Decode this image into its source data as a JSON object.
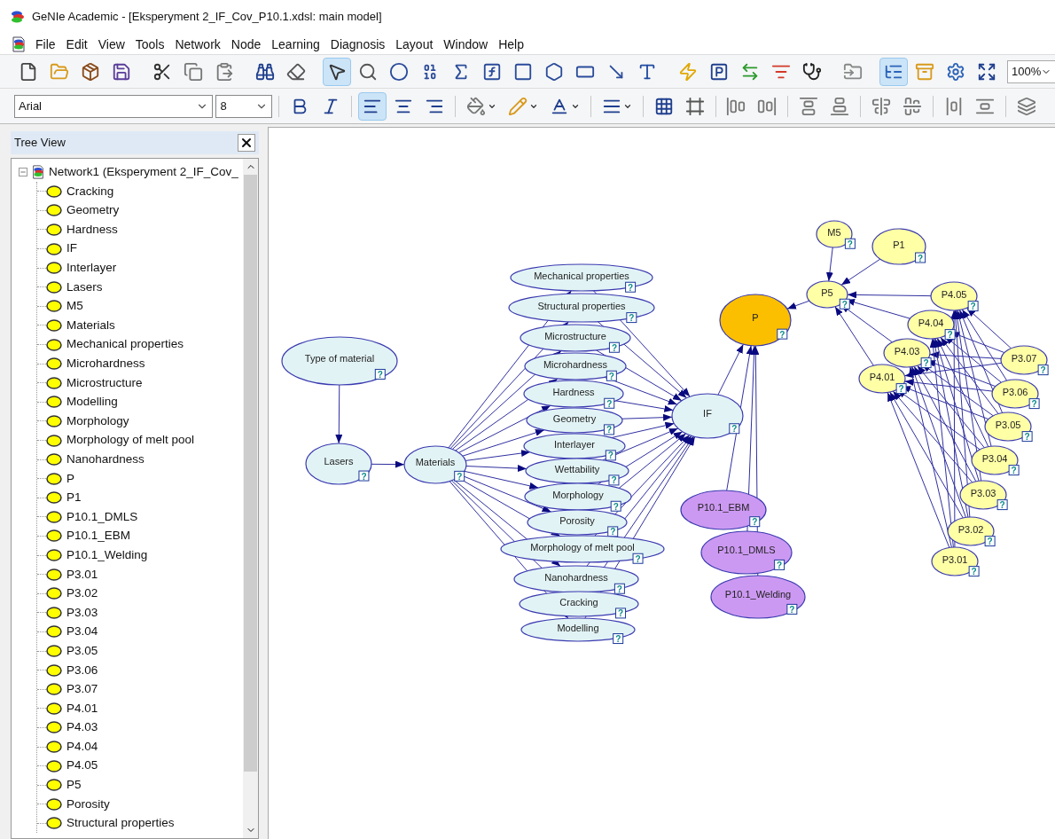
{
  "window": {
    "title": "GeNIe Academic - [Eksperyment 2_IF_Cov_P10.1.xdsl: main model]"
  },
  "menu": [
    "File",
    "Edit",
    "View",
    "Tools",
    "Network",
    "Node",
    "Learning",
    "Diagnosis",
    "Layout",
    "Window",
    "Help"
  ],
  "toolbar_main": {
    "buttons": [
      {
        "kind": "new",
        "pressed": false
      },
      {
        "kind": "open",
        "pressed": false
      },
      {
        "kind": "package",
        "pressed": false
      },
      {
        "kind": "save",
        "pressed": false
      },
      {
        "kind": "separator"
      },
      {
        "kind": "cut",
        "pressed": false
      },
      {
        "kind": "copy",
        "pressed": false
      },
      {
        "kind": "paste",
        "pressed": false
      },
      {
        "kind": "separator"
      },
      {
        "kind": "find",
        "pressed": false
      },
      {
        "kind": "erase",
        "pressed": false
      },
      {
        "kind": "separator"
      },
      {
        "kind": "select",
        "pressed": true
      },
      {
        "kind": "zoom",
        "pressed": false
      },
      {
        "kind": "chance",
        "pressed": false
      },
      {
        "kind": "deterministic",
        "pressed": false
      },
      {
        "kind": "equation",
        "pressed": false
      },
      {
        "kind": "function",
        "pressed": false
      },
      {
        "kind": "rectangle",
        "pressed": false
      },
      {
        "kind": "hexagon",
        "pressed": false
      },
      {
        "kind": "rounded",
        "pressed": false
      },
      {
        "kind": "arc",
        "pressed": false
      },
      {
        "kind": "text",
        "pressed": false
      },
      {
        "kind": "separator"
      },
      {
        "kind": "update",
        "pressed": false
      },
      {
        "kind": "probability",
        "pressed": false
      },
      {
        "kind": "strength",
        "pressed": false
      },
      {
        "kind": "funnel",
        "pressed": false
      },
      {
        "kind": "diagnose",
        "pressed": false
      },
      {
        "kind": "separator"
      },
      {
        "kind": "submodel",
        "pressed": false
      },
      {
        "kind": "separator"
      },
      {
        "kind": "tree",
        "pressed": true
      },
      {
        "kind": "cases",
        "pressed": false
      },
      {
        "kind": "settings",
        "pressed": false
      },
      {
        "kind": "fit",
        "pressed": false
      }
    ],
    "zoom": "100%"
  },
  "toolbar_format": {
    "font": "Arial",
    "size": "8",
    "buttons": [
      {
        "kind": "bold",
        "pressed": false
      },
      {
        "kind": "italic",
        "pressed": false
      },
      {
        "kind": "separator"
      },
      {
        "kind": "align-left",
        "pressed": true
      },
      {
        "kind": "align-center",
        "pressed": false
      },
      {
        "kind": "align-right",
        "pressed": false
      },
      {
        "kind": "separator"
      },
      {
        "kind": "fill",
        "pressed": false
      },
      {
        "kind": "line-color",
        "pressed": false
      },
      {
        "kind": "font-color",
        "pressed": false
      },
      {
        "kind": "separator"
      },
      {
        "kind": "line-width",
        "pressed": false
      },
      {
        "kind": "separator"
      },
      {
        "kind": "grid",
        "pressed": false
      },
      {
        "kind": "snap",
        "pressed": false
      },
      {
        "kind": "separator"
      },
      {
        "kind": "align-lefts",
        "pressed": false
      },
      {
        "kind": "align-rights",
        "pressed": false
      },
      {
        "kind": "separator"
      },
      {
        "kind": "align-tops",
        "pressed": false
      },
      {
        "kind": "align-bottoms",
        "pressed": false
      },
      {
        "kind": "separator"
      },
      {
        "kind": "center-vertical",
        "pressed": false
      },
      {
        "kind": "center-horizontal",
        "pressed": false
      },
      {
        "kind": "separator"
      },
      {
        "kind": "space-horizontal",
        "pressed": false
      },
      {
        "kind": "space-vertical",
        "pressed": false
      },
      {
        "kind": "separator"
      },
      {
        "kind": "same-size",
        "pressed": false
      }
    ]
  },
  "tree_view": {
    "title": "Tree View",
    "root": {
      "label": "Network1 (Eksperyment 2_IF_Cov_",
      "expanded": true,
      "children": [
        {
          "label": "Cracking"
        },
        {
          "label": "Geometry"
        },
        {
          "label": "Hardness"
        },
        {
          "label": "IF"
        },
        {
          "label": "Interlayer"
        },
        {
          "label": "Lasers"
        },
        {
          "label": "M5"
        },
        {
          "label": "Materials"
        },
        {
          "label": "Mechanical properties"
        },
        {
          "label": "Microhardness"
        },
        {
          "label": "Microstructure"
        },
        {
          "label": "Modelling"
        },
        {
          "label": "Morphology"
        },
        {
          "label": "Morphology of melt pool"
        },
        {
          "label": "Nanohardness"
        },
        {
          "label": "P"
        },
        {
          "label": "P1"
        },
        {
          "label": "P10.1_DMLS"
        },
        {
          "label": "P10.1_EBM"
        },
        {
          "label": "P10.1_Welding"
        },
        {
          "label": "P3.01"
        },
        {
          "label": "P3.02"
        },
        {
          "label": "P3.03"
        },
        {
          "label": "P3.04"
        },
        {
          "label": "P3.05"
        },
        {
          "label": "P3.06"
        },
        {
          "label": "P3.07"
        },
        {
          "label": "P4.01"
        },
        {
          "label": "P4.03"
        },
        {
          "label": "P4.04"
        },
        {
          "label": "P4.05"
        },
        {
          "label": "P5"
        },
        {
          "label": "Porosity"
        },
        {
          "label": "Structural properties"
        }
      ]
    }
  },
  "network": {
    "nodes": [
      {
        "label": "Type of material",
        "color": "#e2f3f5",
        "badge": "?"
      },
      {
        "label": "Lasers",
        "color": "#e2f3f5",
        "badge": "?"
      },
      {
        "label": "Materials",
        "color": "#e2f3f5",
        "badge": "?"
      },
      {
        "label": "Mechanical properties",
        "color": "#e2f3f5",
        "badge": "?"
      },
      {
        "label": "Structural properties",
        "color": "#e2f3f5",
        "badge": "?"
      },
      {
        "label": "Microstructure",
        "color": "#e2f3f5",
        "badge": "?"
      },
      {
        "label": "Microhardness",
        "color": "#e2f3f5",
        "badge": "?"
      },
      {
        "label": "Hardness",
        "color": "#e2f3f5",
        "badge": "?"
      },
      {
        "label": "Geometry",
        "color": "#e2f3f5",
        "badge": "?"
      },
      {
        "label": "Interlayer",
        "color": "#e2f3f5",
        "badge": "?"
      },
      {
        "label": "Wettability",
        "color": "#e2f3f5",
        "badge": "?"
      },
      {
        "label": "Morphology",
        "color": "#e2f3f5",
        "badge": "?"
      },
      {
        "label": "Porosity",
        "color": "#e2f3f5",
        "badge": "?"
      },
      {
        "label": "Morphology of melt pool",
        "color": "#e2f3f5",
        "badge": "?"
      },
      {
        "label": "Nanohardness",
        "color": "#e2f3f5",
        "badge": "?"
      },
      {
        "label": "Cracking",
        "color": "#e2f3f5",
        "badge": "?"
      },
      {
        "label": "Modelling",
        "color": "#e2f3f5",
        "badge": "?"
      },
      {
        "label": "IF",
        "color": "#e2f3f5",
        "badge": "?"
      },
      {
        "label": "P",
        "color": "#fbbf00",
        "badge": "?"
      },
      {
        "label": "P10.1_EBM",
        "color": "#cc99f2",
        "badge": "?"
      },
      {
        "label": "P10.1_DMLS",
        "color": "#cc99f2",
        "badge": "?"
      },
      {
        "label": "P10.1_Welding",
        "color": "#cc99f2",
        "badge": "?"
      },
      {
        "label": "M5",
        "color": "#ffffa6",
        "badge": "?"
      },
      {
        "label": "P1",
        "color": "#ffffa6",
        "badge": "?"
      },
      {
        "label": "P5",
        "color": "#ffffa6",
        "badge": "?"
      },
      {
        "label": "P4.05",
        "color": "#ffffa6",
        "badge": "?"
      },
      {
        "label": "P4.04",
        "color": "#ffffa6",
        "badge": "?"
      },
      {
        "label": "P4.03",
        "color": "#ffffa6",
        "badge": "?"
      },
      {
        "label": "P4.01",
        "color": "#ffffa6",
        "badge": "?"
      },
      {
        "label": "P3.07",
        "color": "#ffffa6",
        "badge": "?"
      },
      {
        "label": "P3.06",
        "color": "#ffffa6",
        "badge": "?"
      },
      {
        "label": "P3.05",
        "color": "#ffffa6",
        "badge": "?"
      },
      {
        "label": "P3.04",
        "color": "#ffffa6",
        "badge": "?"
      },
      {
        "label": "P3.03",
        "color": "#ffffa6",
        "badge": "?"
      },
      {
        "label": "P3.02",
        "color": "#ffffa6",
        "badge": "?"
      },
      {
        "label": "P3.01",
        "color": "#ffffa6",
        "badge": "?"
      }
    ]
  }
}
